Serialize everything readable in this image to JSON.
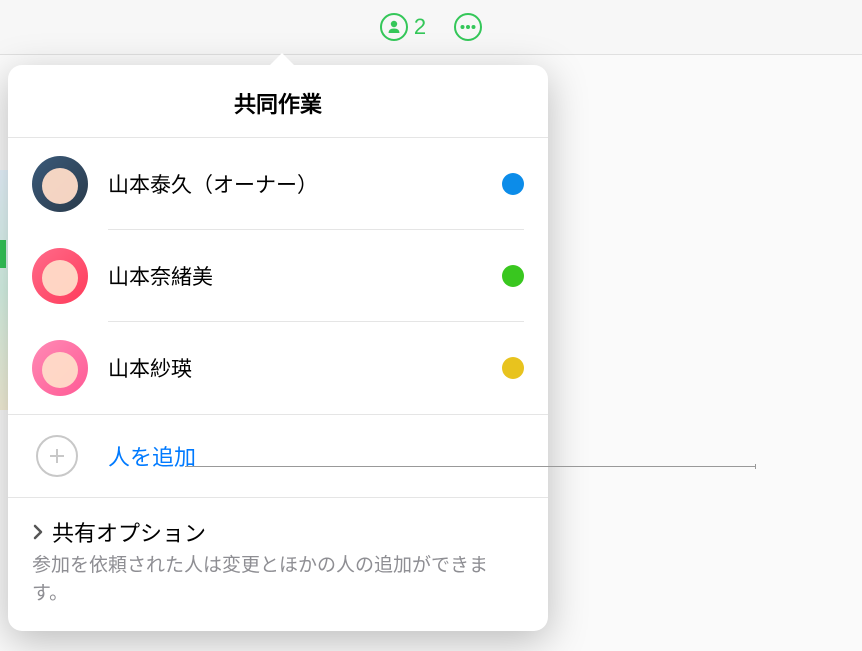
{
  "toolbar": {
    "people_count": "2"
  },
  "popover": {
    "title": "共同作業",
    "participants": [
      {
        "name": "山本泰久（オーナー）",
        "status_color": "#0c8ce9"
      },
      {
        "name": "山本奈緒美",
        "status_color": "#39c71f"
      },
      {
        "name": "山本紗瑛",
        "status_color": "#e8c31e"
      }
    ],
    "add_label": "人を追加",
    "options": {
      "title": "共有オプション",
      "description": "参加を依頼された人は変更とほかの人の追加ができます。"
    }
  }
}
